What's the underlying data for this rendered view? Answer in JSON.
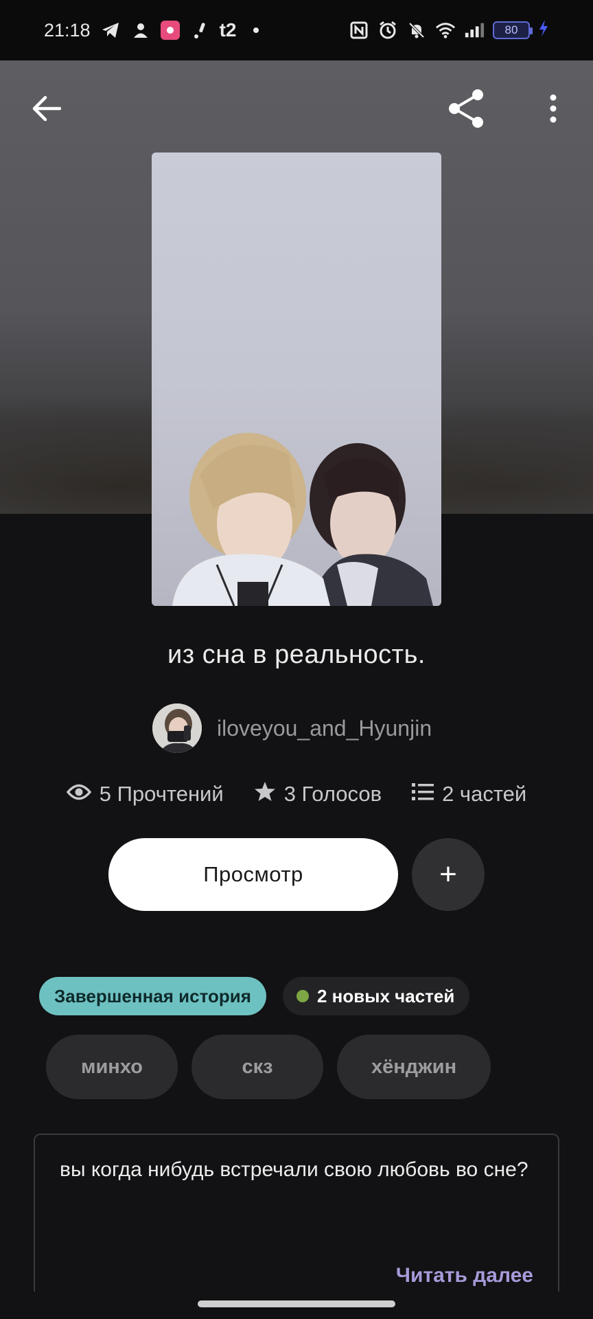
{
  "status_bar": {
    "time": "21:18",
    "carrier_label": "t2",
    "battery_level": "80",
    "left_icons": [
      "telegram-icon",
      "person-icon",
      "app-pink-icon",
      "notification-icon",
      "t2-icon",
      "dot-icon"
    ],
    "right_icons": [
      "nfc-icon",
      "alarm-icon",
      "bell-off-icon",
      "wifi-icon",
      "signal-icon",
      "battery-icon",
      "charging-icon"
    ]
  },
  "header": {
    "back_icon": "arrow-left-icon",
    "share_icon": "share-icon",
    "more_icon": "more-vertical-icon"
  },
  "story": {
    "title": "из сна в реальность.",
    "author": "iloveyou_and_Hyunjin",
    "stats": {
      "reads": "5 Прочтений",
      "votes": "3 Голосов",
      "parts": "2 частей"
    },
    "read_button": "Просмотр",
    "add_button": "+",
    "status_badge": "Завершенная история",
    "new_parts_badge": "2 новых частей",
    "tags": [
      "минхо",
      "скз",
      "хёнджин"
    ],
    "description": "вы когда нибудь встречали свою любовь во сне?",
    "read_more": "Читать далее"
  },
  "colors": {
    "background": "#121113",
    "complete_badge": "#6ec1c1",
    "new_dot": "#7da744",
    "read_more": "#a79ad9"
  }
}
